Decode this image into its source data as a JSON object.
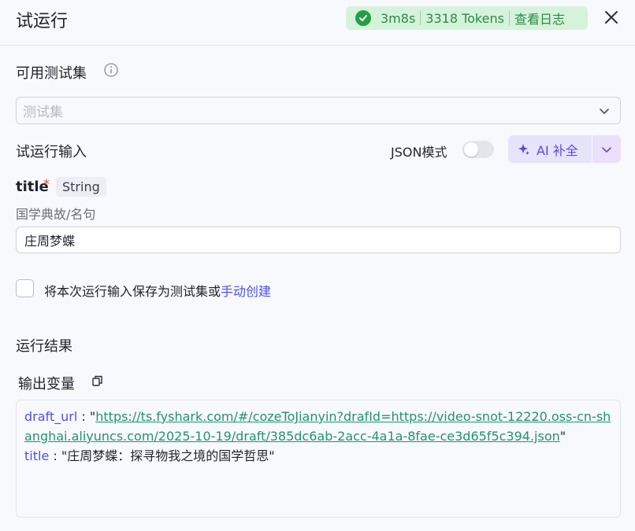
{
  "header": {
    "title": "试运行",
    "status": {
      "duration": "3m8s",
      "tokens": "3318 Tokens",
      "log_label": "查看日志",
      "color": "#23a046"
    }
  },
  "test_set": {
    "title": "可用测试集",
    "placeholder": "测试集"
  },
  "run_input": {
    "title": "试运行输入",
    "json_mode_label": "JSON模式",
    "json_mode_on": false,
    "ai_button_label": "AI 补全",
    "field": {
      "name": "title",
      "required_mark": "*",
      "type": "String",
      "description": "国学典故/名句",
      "value": "庄周梦蝶"
    },
    "save_text": "将本次运行输入保存为测试集或",
    "manual_link": "手动创建"
  },
  "result": {
    "title": "运行结果",
    "output_title": "输出变量",
    "outputs": [
      {
        "key": "draft_url",
        "value": "https://ts.fyshark.com/#/cozeToJianyin?drafId=https://video-snot-12220.oss-cn-shanghai.aliyuncs.com/2025-10-19/draft/385dc6ab-2acc-4a1a-8fae-ce3d65f5c394.json"
      },
      {
        "key": "title",
        "value": "庄周梦蝶：探寻物我之境的国学哲思"
      }
    ]
  }
}
